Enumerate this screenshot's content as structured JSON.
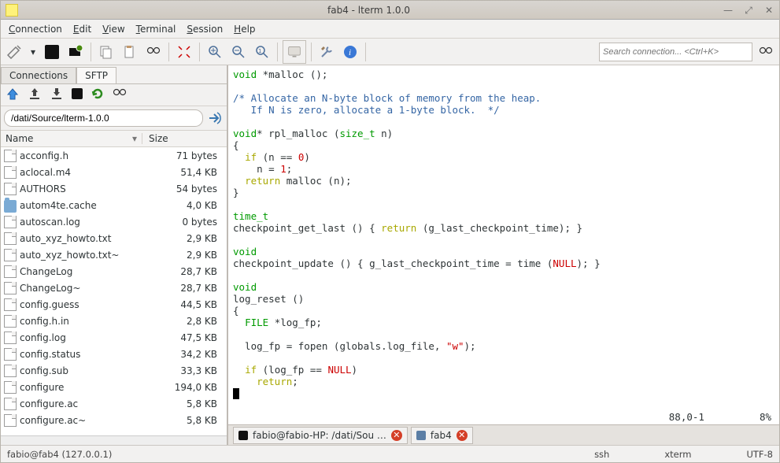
{
  "title": "fab4 - lterm 1.0.0",
  "menu": [
    "Connection",
    "Edit",
    "View",
    "Terminal",
    "Session",
    "Help"
  ],
  "search_placeholder": "Search connection... <Ctrl+K>",
  "side_tabs": {
    "connections": "Connections",
    "sftp": "SFTP"
  },
  "path": "/dati/Source/lterm-1.0.0",
  "file_headers": {
    "name": "Name",
    "size": "Size"
  },
  "files": [
    {
      "name": "acconfig.h",
      "size": "71 bytes",
      "type": "file"
    },
    {
      "name": "aclocal.m4",
      "size": "51,4 KB",
      "type": "file"
    },
    {
      "name": "AUTHORS",
      "size": "54 bytes",
      "type": "file"
    },
    {
      "name": "autom4te.cache",
      "size": "4,0 KB",
      "type": "folder"
    },
    {
      "name": "autoscan.log",
      "size": "0 bytes",
      "type": "file"
    },
    {
      "name": "auto_xyz_howto.txt",
      "size": "2,9 KB",
      "type": "file"
    },
    {
      "name": "auto_xyz_howto.txt~",
      "size": "2,9 KB",
      "type": "file"
    },
    {
      "name": "ChangeLog",
      "size": "28,7 KB",
      "type": "file"
    },
    {
      "name": "ChangeLog~",
      "size": "28,7 KB",
      "type": "file"
    },
    {
      "name": "config.guess",
      "size": "44,5 KB",
      "type": "file"
    },
    {
      "name": "config.h.in",
      "size": "2,8 KB",
      "type": "file"
    },
    {
      "name": "config.log",
      "size": "47,5 KB",
      "type": "file"
    },
    {
      "name": "config.status",
      "size": "34,2 KB",
      "type": "file"
    },
    {
      "name": "config.sub",
      "size": "33,3 KB",
      "type": "file"
    },
    {
      "name": "configure",
      "size": "194,0 KB",
      "type": "file"
    },
    {
      "name": "configure.ac",
      "size": "5,8 KB",
      "type": "file"
    },
    {
      "name": "configure.ac~",
      "size": "5,8 KB",
      "type": "file"
    }
  ],
  "code_status": {
    "pos": "88,0-1",
    "pct": "8%"
  },
  "term_tabs": [
    {
      "label": "fabio@fabio-HP: /dati/Sou …"
    },
    {
      "label": "fab4"
    }
  ],
  "status": {
    "host": "fabio@fab4 (127.0.0.1)",
    "conn": "ssh",
    "term": "xterm",
    "enc": "UTF-8"
  }
}
